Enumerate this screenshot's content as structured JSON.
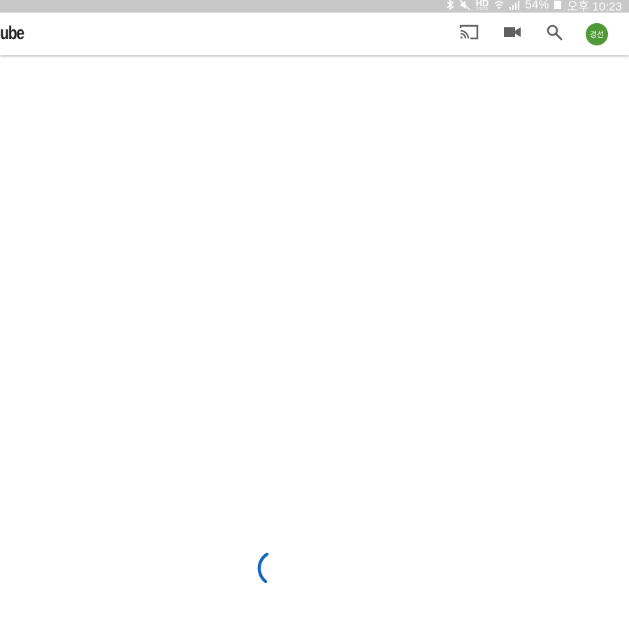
{
  "status_bar": {
    "battery_percent": "54%",
    "time": "오후 10:23",
    "hd_label": "HD",
    "voice_label": "VOICE",
    "icons": [
      "bluetooth-icon",
      "mute-icon",
      "hd-voice-icon",
      "wifi-icon",
      "signal-icon",
      "battery-icon"
    ]
  },
  "app_bar": {
    "brand": "ube",
    "avatar_text": "경선",
    "actions": [
      "cast-icon",
      "camera-icon",
      "search-icon"
    ]
  },
  "colors": {
    "status_bar_bg": "#c8c8c8",
    "avatar_bg": "#4f9a36",
    "spinner": "#1565c0",
    "icon": "#606060"
  },
  "content": {
    "state": "loading"
  }
}
